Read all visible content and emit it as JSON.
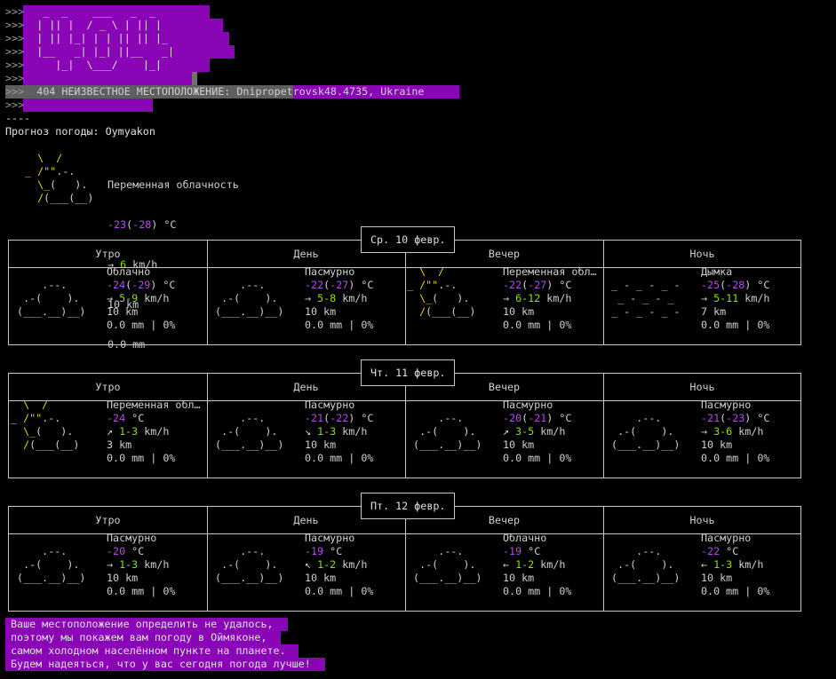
{
  "banner": {
    "prompt": ">>>",
    "ascii_lines": [
      "   _  _    ___   _  _",
      "  | || |  / _ \\ | || |",
      "  | || |_| | | || || |_",
      "  |__   _| |_| ||__   _|",
      "     |_|  \\___/    |_|",
      ""
    ],
    "error_line": "  404 НЕИЗВЕСТНОЕ МЕСТОПОЛОЖЕНИЕ: Dnipropetrovsk48.4735, Ukraine",
    "separator": "----"
  },
  "forecast_title": "Прогноз погоды: Oymyakon",
  "current": {
    "icon": "partly-cloudy",
    "condition": "Переменная облачность",
    "temp": "-23",
    "feels": "-28",
    "temp_unit": " °C",
    "wind_dir": "→",
    "wind": "6",
    "wind_unit": " km/h",
    "visibility": "10 km",
    "precip": "0.0 mm"
  },
  "periods": [
    "Утро",
    "День",
    "Вечер",
    "Ночь"
  ],
  "days": [
    {
      "date": "Ср. 10 февр.",
      "cells": [
        {
          "icon": "cloudy",
          "condition": "Облачно",
          "temp": "-24",
          "feels": "-29",
          "wind_dir": "→",
          "wind": "5-9",
          "visibility": "10 km",
          "precip": "0.0 mm | 0%"
        },
        {
          "icon": "cloudy",
          "condition": "Пасмурно",
          "temp": "-22",
          "feels": "-27",
          "wind_dir": "→",
          "wind": "5-8",
          "visibility": "10 km",
          "precip": "0.0 mm | 0%"
        },
        {
          "icon": "partly-cloudy",
          "condition": "Переменная обл…",
          "temp": "-22",
          "feels": "-27",
          "wind_dir": "→",
          "wind": "6-12",
          "visibility": "10 km",
          "precip": "0.0 mm | 0%"
        },
        {
          "icon": "fog",
          "condition": "Дымка",
          "temp": "-25",
          "feels": "-28",
          "wind_dir": "→",
          "wind": "5-11",
          "visibility": "7 km",
          "precip": "0.0 mm | 0%"
        }
      ]
    },
    {
      "date": "Чт. 11 февр.",
      "cells": [
        {
          "icon": "partly-cloudy",
          "condition": "Переменная обл…",
          "temp": "-24",
          "feels": "",
          "wind_dir": "↗",
          "wind": "1-3",
          "visibility": "3 km",
          "precip": "0.0 mm | 0%"
        },
        {
          "icon": "cloudy",
          "condition": "Пасмурно",
          "temp": "-21",
          "feels": "-22",
          "wind_dir": "↘",
          "wind": "1-3",
          "visibility": "10 km",
          "precip": "0.0 mm | 0%"
        },
        {
          "icon": "cloudy",
          "condition": "Пасмурно",
          "temp": "-20",
          "feels": "-21",
          "wind_dir": "↗",
          "wind": "3-5",
          "visibility": "10 km",
          "precip": "0.0 mm | 0%"
        },
        {
          "icon": "cloudy",
          "condition": "Пасмурно",
          "temp": "-21",
          "feels": "-23",
          "wind_dir": "→",
          "wind": "3-6",
          "visibility": "10 km",
          "precip": "0.0 mm | 0%"
        }
      ]
    },
    {
      "date": "Пт. 12 февр.",
      "cells": [
        {
          "icon": "cloudy",
          "condition": "Пасмурно",
          "temp": "-20",
          "feels": "",
          "wind_dir": "→",
          "wind": "1-3",
          "visibility": "10 km",
          "precip": "0.0 mm | 0%"
        },
        {
          "icon": "cloudy",
          "condition": "Пасмурно",
          "temp": "-19",
          "feels": "",
          "wind_dir": "↖",
          "wind": "1-2",
          "visibility": "10 km",
          "precip": "0.0 mm | 0%"
        },
        {
          "icon": "cloudy",
          "condition": "Облачно",
          "temp": "-19",
          "feels": "",
          "wind_dir": "←",
          "wind": "1-2",
          "visibility": "10 km",
          "precip": "0.0 mm | 0%"
        },
        {
          "icon": "cloudy",
          "condition": "Пасмурно",
          "temp": "-22",
          "feels": "",
          "wind_dir": "←",
          "wind": "1-3",
          "visibility": "10 km",
          "precip": "0.0 mm | 0%"
        }
      ]
    }
  ],
  "footer_lines": [
    "Ваше местоположение определить не удалось,",
    "поэтому мы покажем вам погоду в Оймяконе,",
    "самом холодном населённом пункте на планете.",
    "Будем надеяться, что у вас сегодня погода лучше!"
  ],
  "colors": {
    "background": "#000000",
    "highlight": "#8a05b5",
    "sun": "#e8d500",
    "temperature": "#b04fe0",
    "wind": "#8ee000"
  }
}
